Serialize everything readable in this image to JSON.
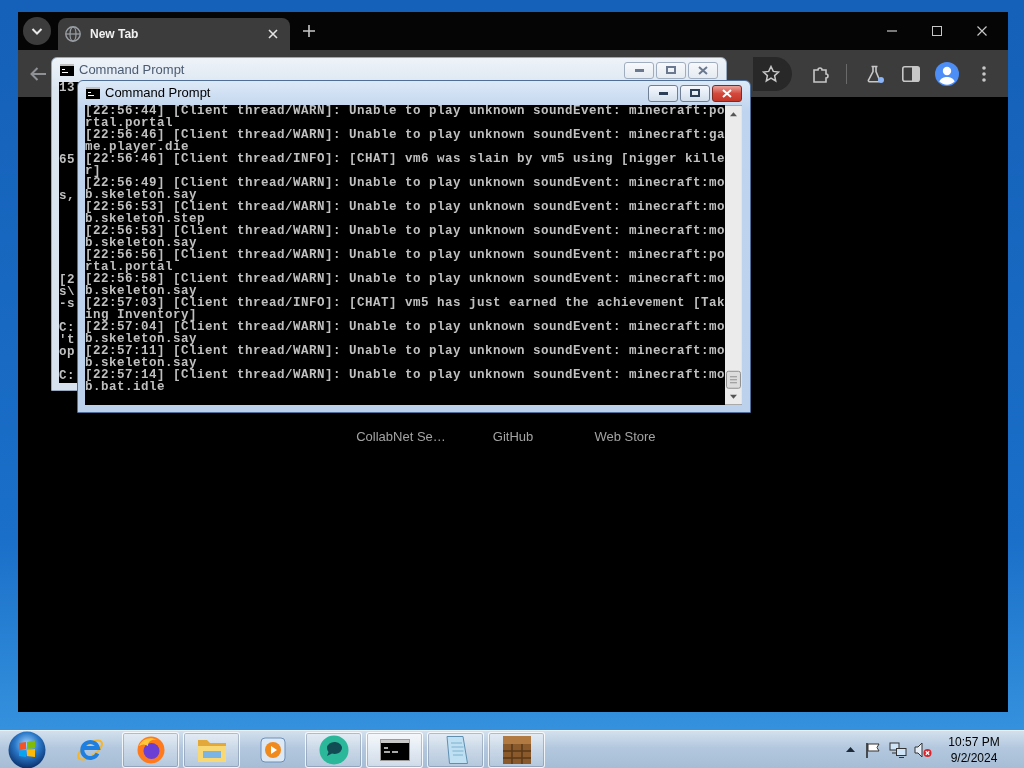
{
  "browser": {
    "tabs": [
      {
        "title": "New Tab",
        "selected": true
      }
    ],
    "shortcuts": [
      {
        "label": "CollabNet Se…"
      },
      {
        "label": "GitHub"
      },
      {
        "label": "Web Store"
      }
    ]
  },
  "windows": [
    {
      "title": "Command Prompt",
      "active": false,
      "lines": [
        {
          "kind": "text",
          "text": "13"
        },
        {
          "kind": "blank"
        },
        {
          "kind": "blank"
        },
        {
          "kind": "blank"
        },
        {
          "kind": "blank"
        },
        {
          "kind": "blank"
        },
        {
          "kind": "text",
          "text": "65"
        },
        {
          "kind": "blank"
        },
        {
          "kind": "blank"
        },
        {
          "kind": "text",
          "text": "s,"
        },
        {
          "kind": "blank"
        },
        {
          "kind": "blank"
        },
        {
          "kind": "blank"
        },
        {
          "kind": "blank"
        },
        {
          "kind": "blank"
        },
        {
          "kind": "blank"
        },
        {
          "kind": "text",
          "text": "[2"
        },
        {
          "kind": "text",
          "text": "s\\"
        },
        {
          "kind": "text",
          "text": "-s"
        },
        {
          "kind": "blank"
        },
        {
          "kind": "text",
          "text": "C:"
        },
        {
          "kind": "text",
          "text": "'t"
        },
        {
          "kind": "text",
          "text": "op"
        },
        {
          "kind": "blank"
        },
        {
          "kind": "text",
          "text": "C:"
        }
      ]
    },
    {
      "title": "Command Prompt",
      "active": true,
      "lines": [
        "[22:56:44] [Client thread/WARN]: Unable to play unknown soundEvent: minecraft:po",
        "rtal.portal",
        "[22:56:46] [Client thread/WARN]: Unable to play unknown soundEvent: minecraft:ga",
        "me.player.die",
        "[22:56:46] [Client thread/INFO]: [CHAT] vm6 was slain by vm5 using [nigger kille",
        "r]",
        "[22:56:49] [Client thread/WARN]: Unable to play unknown soundEvent: minecraft:mo",
        "b.skeleton.say",
        "[22:56:53] [Client thread/WARN]: Unable to play unknown soundEvent: minecraft:mo",
        "b.skeleton.step",
        "[22:56:53] [Client thread/WARN]: Unable to play unknown soundEvent: minecraft:mo",
        "b.skeleton.say",
        "[22:56:56] [Client thread/WARN]: Unable to play unknown soundEvent: minecraft:po",
        "rtal.portal",
        "[22:56:58] [Client thread/WARN]: Unable to play unknown soundEvent: minecraft:mo",
        "b.skeleton.say",
        "[22:57:03] [Client thread/INFO]: [CHAT] vm5 has just earned the achievement [Tak",
        "ing Inventory]",
        "[22:57:04] [Client thread/WARN]: Unable to play unknown soundEvent: minecraft:mo",
        "b.skeleton.say",
        "[22:57:11] [Client thread/WARN]: Unable to play unknown soundEvent: minecraft:mo",
        "b.skeleton.say",
        "[22:57:14] [Client thread/WARN]: Unable to play unknown soundEvent: minecraft:mo",
        "b.bat.idle"
      ]
    }
  ],
  "taskbar": {
    "apps": [
      {
        "kind": "e",
        "running": false,
        "selected": false
      },
      {
        "kind": "fox",
        "running": true,
        "selected": false
      },
      {
        "kind": "folder",
        "running": true,
        "selected": false
      },
      {
        "kind": "player",
        "running": false,
        "selected": false
      },
      {
        "kind": "bubble",
        "running": true,
        "selected": false
      },
      {
        "kind": "console",
        "running": true,
        "selected": true
      },
      {
        "kind": "notepad",
        "running": true,
        "selected": false
      },
      {
        "kind": "crate",
        "running": true,
        "selected": false
      }
    ],
    "clock": {
      "time": "10:57 PM",
      "date": "9/2/2024"
    }
  }
}
